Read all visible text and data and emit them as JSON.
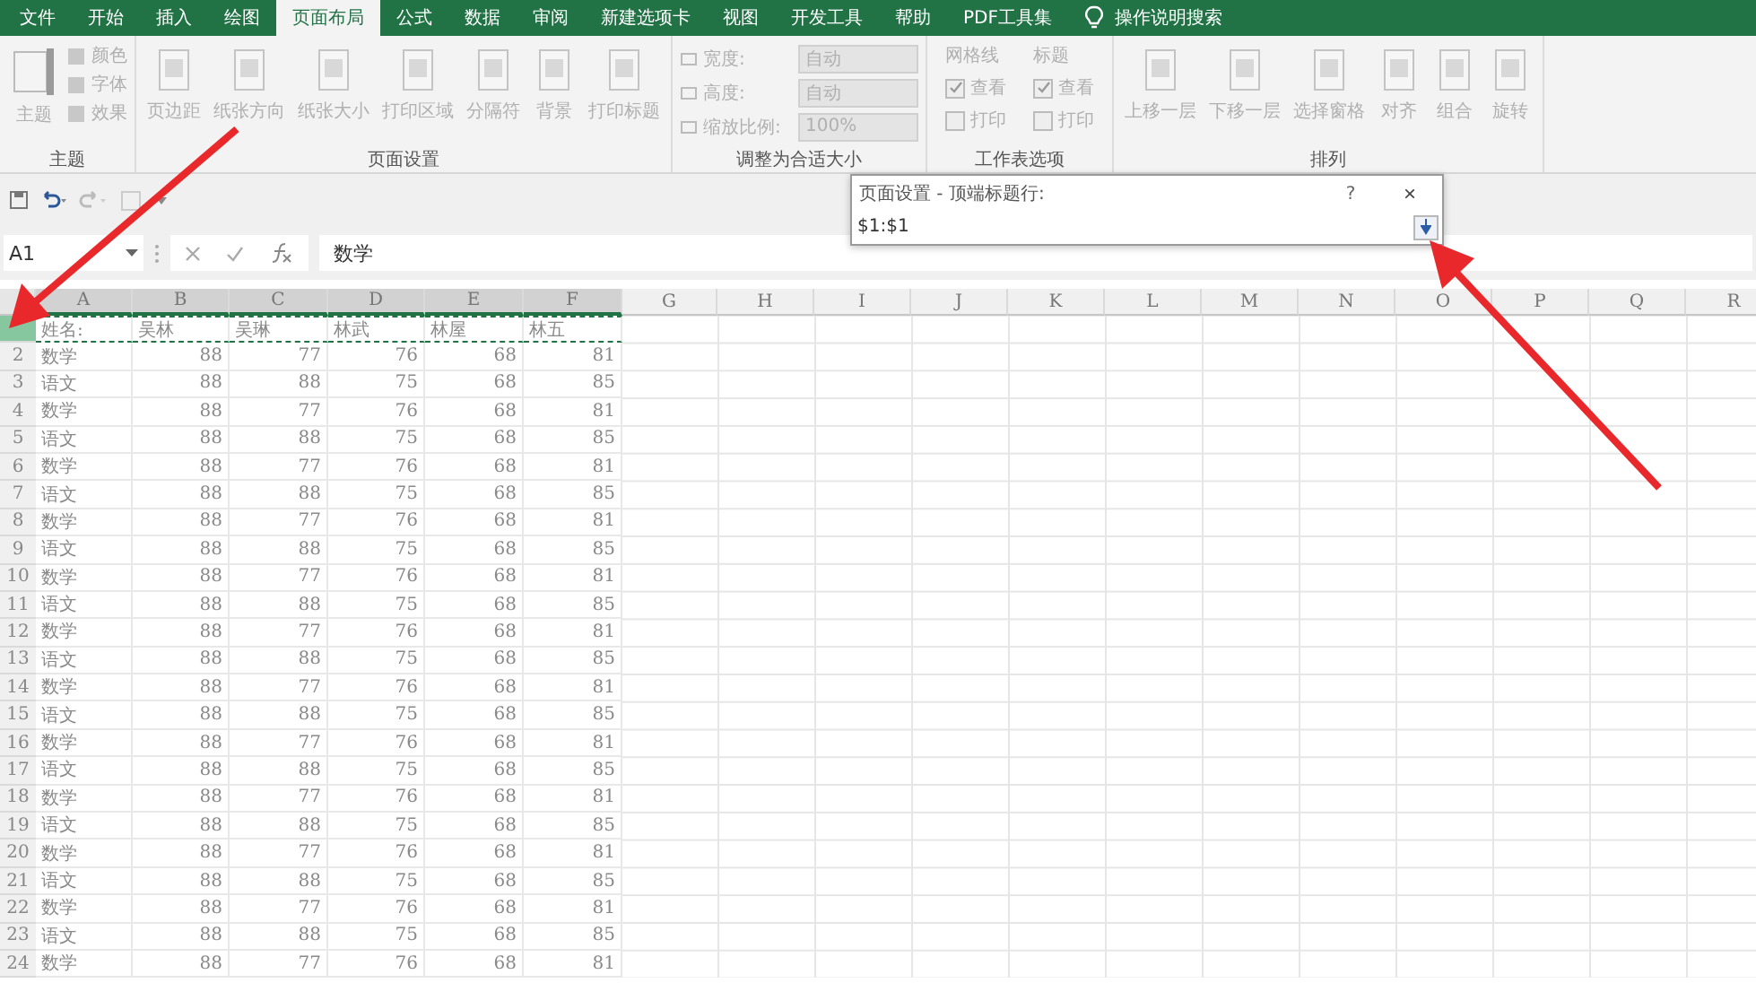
{
  "tabs": [
    {
      "label": "文件",
      "selected": false
    },
    {
      "label": "开始",
      "selected": false
    },
    {
      "label": "插入",
      "selected": false
    },
    {
      "label": "绘图",
      "selected": false
    },
    {
      "label": "页面布局",
      "selected": true
    },
    {
      "label": "公式",
      "selected": false
    },
    {
      "label": "数据",
      "selected": false
    },
    {
      "label": "审阅",
      "selected": false
    },
    {
      "label": "新建选项卡",
      "selected": false
    },
    {
      "label": "视图",
      "selected": false
    },
    {
      "label": "开发工具",
      "selected": false
    },
    {
      "label": "帮助",
      "selected": false
    },
    {
      "label": "PDF工具集",
      "selected": false
    }
  ],
  "tell_me": {
    "label": "操作说明搜索"
  },
  "ribbon": {
    "disabled": true,
    "groups": [
      {
        "label": "主题",
        "kind": "theme",
        "big": "主题",
        "small": [
          "颜色",
          "字体",
          "效果"
        ]
      },
      {
        "label": "页面设置",
        "kind": "buttons",
        "items": [
          "页边距",
          "纸张方向",
          "纸张大小",
          "打印区域",
          "分隔符",
          "背景",
          "打印标题"
        ]
      },
      {
        "label": "调整为合适大小",
        "kind": "scale",
        "fields": [
          {
            "label": "宽度:",
            "value": "自动"
          },
          {
            "label": "高度:",
            "value": "自动"
          },
          {
            "label": "缩放比例:",
            "value": "100%"
          }
        ]
      },
      {
        "label": "工作表选项",
        "kind": "sheet_options",
        "columns": [
          {
            "title": "网格线",
            "options": [
              {
                "label": "查看",
                "checked": true
              },
              {
                "label": "打印",
                "checked": false
              }
            ]
          },
          {
            "title": "标题",
            "options": [
              {
                "label": "查看",
                "checked": true
              },
              {
                "label": "打印",
                "checked": false
              }
            ]
          }
        ]
      },
      {
        "label": "排列",
        "kind": "buttons",
        "items": [
          "上移一层",
          "下移一层",
          "选择窗格",
          "对齐",
          "组合",
          "旋转"
        ]
      }
    ]
  },
  "formula_bar": {
    "name_box": "A1",
    "formula": "数学"
  },
  "dialog": {
    "title": "页面设置 - 顶端标题行:",
    "help": "?",
    "close": "×",
    "value": "$1:$1"
  },
  "sheet": {
    "columns": [
      {
        "label": "A",
        "selected": true
      },
      {
        "label": "B",
        "selected": true
      },
      {
        "label": "C",
        "selected": true
      },
      {
        "label": "D",
        "selected": true
      },
      {
        "label": "E",
        "selected": true
      },
      {
        "label": "F",
        "selected": true
      },
      {
        "label": "G",
        "selected": false
      },
      {
        "label": "H",
        "selected": false
      },
      {
        "label": "I",
        "selected": false
      },
      {
        "label": "J",
        "selected": false
      },
      {
        "label": "K",
        "selected": false
      },
      {
        "label": "L",
        "selected": false
      },
      {
        "label": "M",
        "selected": false
      },
      {
        "label": "N",
        "selected": false
      },
      {
        "label": "O",
        "selected": false
      },
      {
        "label": "P",
        "selected": false
      },
      {
        "label": "Q",
        "selected": false
      },
      {
        "label": "R",
        "selected": false
      }
    ],
    "rows": [
      {
        "selected": true,
        "cells": [
          "姓名:",
          "吴林",
          "吴琳",
          "林武",
          "林屋",
          "林五"
        ]
      },
      {
        "number": "2",
        "selected": false,
        "cells": [
          "数学",
          "88",
          "77",
          "76",
          "68",
          "81"
        ]
      },
      {
        "number": "3",
        "selected": false,
        "cells": [
          "语文",
          "88",
          "88",
          "75",
          "68",
          "85"
        ]
      },
      {
        "number": "4",
        "selected": false,
        "cells": [
          "数学",
          "88",
          "77",
          "76",
          "68",
          "81"
        ]
      },
      {
        "number": "5",
        "selected": false,
        "cells": [
          "语文",
          "88",
          "88",
          "75",
          "68",
          "85"
        ]
      },
      {
        "number": "6",
        "selected": false,
        "cells": [
          "数学",
          "88",
          "77",
          "76",
          "68",
          "81"
        ]
      },
      {
        "number": "7",
        "selected": false,
        "cells": [
          "语文",
          "88",
          "88",
          "75",
          "68",
          "85"
        ]
      },
      {
        "number": "8",
        "selected": false,
        "cells": [
          "数学",
          "88",
          "77",
          "76",
          "68",
          "81"
        ]
      },
      {
        "number": "9",
        "selected": false,
        "cells": [
          "语文",
          "88",
          "88",
          "75",
          "68",
          "85"
        ]
      },
      {
        "number": "10",
        "selected": false,
        "cells": [
          "数学",
          "88",
          "77",
          "76",
          "68",
          "81"
        ]
      },
      {
        "number": "11",
        "selected": false,
        "cells": [
          "语文",
          "88",
          "88",
          "75",
          "68",
          "85"
        ]
      },
      {
        "number": "12",
        "selected": false,
        "cells": [
          "数学",
          "88",
          "77",
          "76",
          "68",
          "81"
        ]
      },
      {
        "number": "13",
        "selected": false,
        "cells": [
          "语文",
          "88",
          "88",
          "75",
          "68",
          "85"
        ]
      },
      {
        "number": "14",
        "selected": false,
        "cells": [
          "数学",
          "88",
          "77",
          "76",
          "68",
          "81"
        ]
      },
      {
        "number": "15",
        "selected": false,
        "cells": [
          "语文",
          "88",
          "88",
          "75",
          "68",
          "85"
        ]
      },
      {
        "number": "16",
        "selected": false,
        "cells": [
          "数学",
          "88",
          "77",
          "76",
          "68",
          "81"
        ]
      },
      {
        "number": "17",
        "selected": false,
        "cells": [
          "语文",
          "88",
          "88",
          "75",
          "68",
          "85"
        ]
      },
      {
        "number": "18",
        "selected": false,
        "cells": [
          "数学",
          "88",
          "77",
          "76",
          "68",
          "81"
        ]
      },
      {
        "number": "19",
        "selected": false,
        "cells": [
          "语文",
          "88",
          "88",
          "75",
          "68",
          "85"
        ]
      },
      {
        "number": "20",
        "selected": false,
        "cells": [
          "数学",
          "88",
          "77",
          "76",
          "68",
          "81"
        ]
      },
      {
        "number": "21",
        "selected": false,
        "cells": [
          "语文",
          "88",
          "88",
          "75",
          "68",
          "85"
        ]
      },
      {
        "number": "22",
        "selected": false,
        "cells": [
          "数学",
          "88",
          "77",
          "76",
          "68",
          "81"
        ]
      },
      {
        "number": "23",
        "selected": false,
        "cells": [
          "语文",
          "88",
          "88",
          "75",
          "68",
          "85"
        ]
      },
      {
        "number": "24",
        "selected": false,
        "cells": [
          "数学",
          "88",
          "77",
          "76",
          "68",
          "81"
        ]
      }
    ]
  }
}
